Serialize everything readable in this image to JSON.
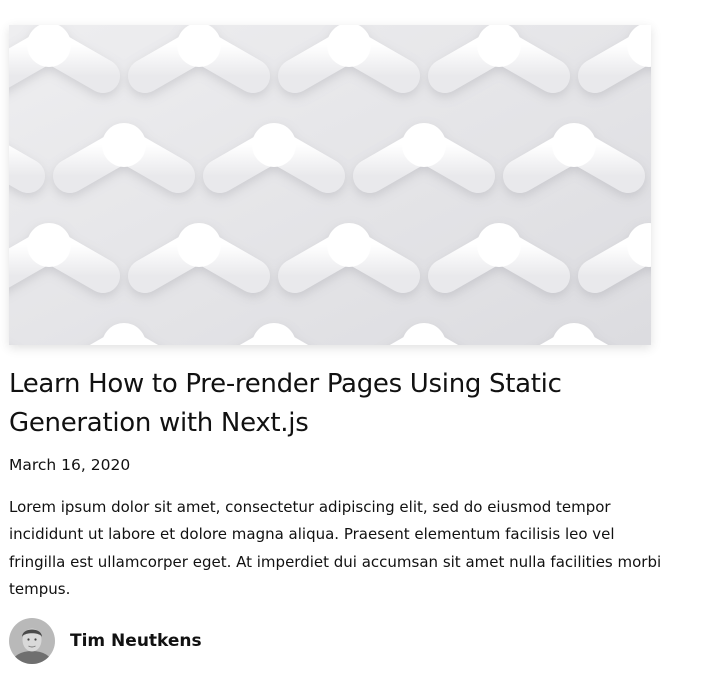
{
  "post": {
    "cover_image": "abstract-white-lattice-image",
    "title": "Learn How to Pre-render Pages Using Static Generation with Next.js",
    "date": "March 16, 2020",
    "excerpt": "Lorem ipsum dolor sit amet, consectetur adipiscing elit, sed do eiusmod tempor incididunt ut labore et dolore magna aliqua. Praesent elementum facilisis leo vel fringilla est ullamcorper eget. At imperdiet dui accumsan sit amet nulla facilities morbi tempus.",
    "author": {
      "name": "Tim Neutkens",
      "avatar": "author-avatar-photo"
    }
  },
  "colors": {
    "text": "#111111",
    "background": "#ffffff",
    "cover_base": "#e7e7ea"
  }
}
